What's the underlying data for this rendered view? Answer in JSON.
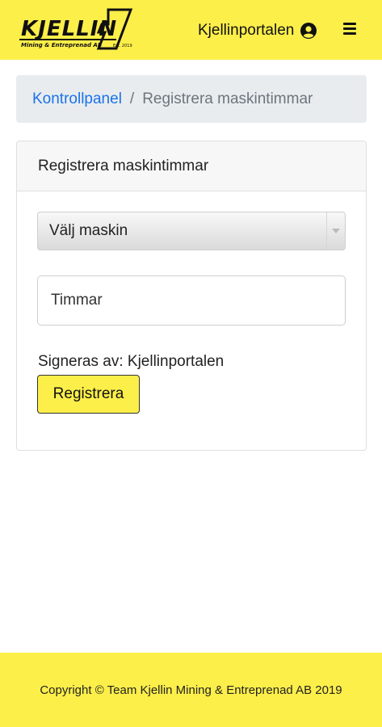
{
  "header": {
    "logo_name": "KJELLIN",
    "logo_tagline": "Mining & Entreprenad AB",
    "logo_est": "Est. 2019",
    "username": "Kjellinportalen",
    "user_icon": "user-circle-icon",
    "menu_icon": "hamburger-icon"
  },
  "breadcrumb": {
    "home": "Kontrollpanel",
    "separator": "/",
    "current": "Registrera maskintimmar"
  },
  "card": {
    "title": "Registrera maskintimmar",
    "machine_select": {
      "selected": "Välj maskin"
    },
    "hours_input": {
      "placeholder": "Timmar",
      "value": ""
    },
    "signed_by": "Signeras av: Kjellinportalen",
    "submit_label": "Registrera"
  },
  "footer": {
    "copyright": "Copyright © Team Kjellin Mining & Entreprenad AB 2019"
  },
  "colors": {
    "brand_yellow": "#fdef4a",
    "link_blue": "#1a73e8",
    "breadcrumb_bg": "#e9ecef"
  }
}
